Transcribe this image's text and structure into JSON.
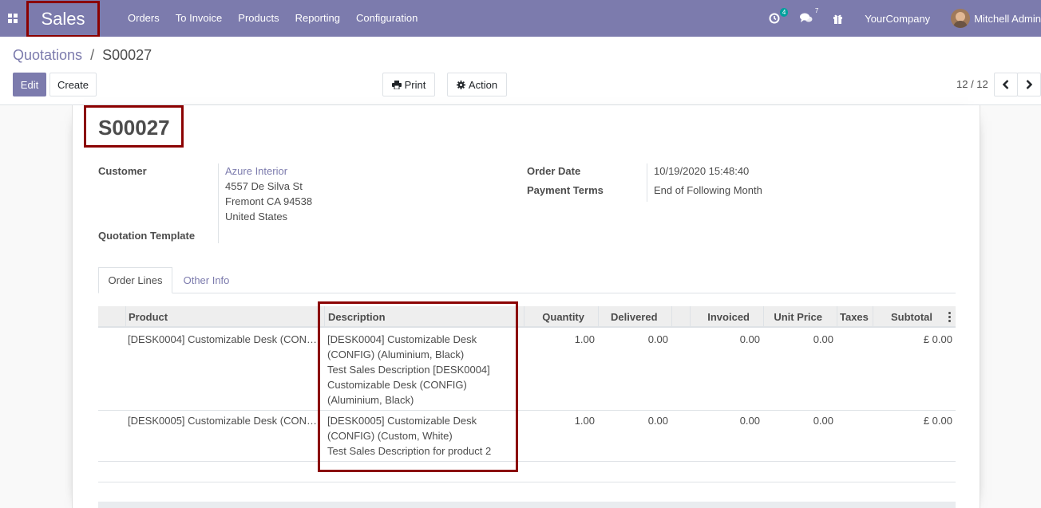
{
  "navbar": {
    "app_name": "Sales",
    "menu": [
      "Orders",
      "To Invoice",
      "Products",
      "Reporting",
      "Configuration"
    ],
    "activity_count": "4",
    "messages_count": "7",
    "company": "YourCompany",
    "user": "Mitchell Admin",
    "color": "#7c7bad"
  },
  "breadcrumb": {
    "parent": "Quotations",
    "separator": "/",
    "current": "S00027"
  },
  "buttons": {
    "edit": "Edit",
    "create": "Create",
    "print": "Print",
    "action": "Action"
  },
  "pager": {
    "value": "12 / 12"
  },
  "form": {
    "title": "S00027",
    "customer_label": "Customer",
    "customer_name": "Azure Interior",
    "address_line1": "4557 De Silva St",
    "address_line2": "Fremont CA 94538",
    "address_line3": "United States",
    "quotation_template_label": "Quotation Template",
    "order_date_label": "Order Date",
    "order_date": "10/19/2020 15:48:40",
    "payment_terms_label": "Payment Terms",
    "payment_terms": "End of Following Month"
  },
  "tabs": [
    "Order Lines",
    "Other Info"
  ],
  "table": {
    "headers": {
      "product": "Product",
      "description": "Description",
      "quantity": "Quantity",
      "delivered": "Delivered",
      "invoiced": "Invoiced",
      "unit_price": "Unit Price",
      "taxes": "Taxes",
      "subtotal": "Subtotal"
    },
    "rows": [
      {
        "product": "[DESK0004] Customizable Desk (CON…",
        "description": [
          "[DESK0004] Customizable Desk",
          "(CONFIG) (Aluminium, Black)",
          "Test Sales Description [DESK0004]",
          "Customizable Desk (CONFIG)",
          "(Aluminium, Black)"
        ],
        "quantity": "1.00",
        "delivered": "0.00",
        "invoiced": "0.00",
        "unit_price": "0.00",
        "subtotal": "£ 0.00"
      },
      {
        "product": "[DESK0005] Customizable Desk (CON…",
        "description": [
          "[DESK0005] Customizable Desk",
          "(CONFIG) (Custom, White)",
          "Test Sales Description for product 2"
        ],
        "quantity": "1.00",
        "delivered": "0.00",
        "invoiced": "0.00",
        "unit_price": "0.00",
        "subtotal": "£ 0.00"
      }
    ]
  },
  "highlight_color": "#8b0000"
}
